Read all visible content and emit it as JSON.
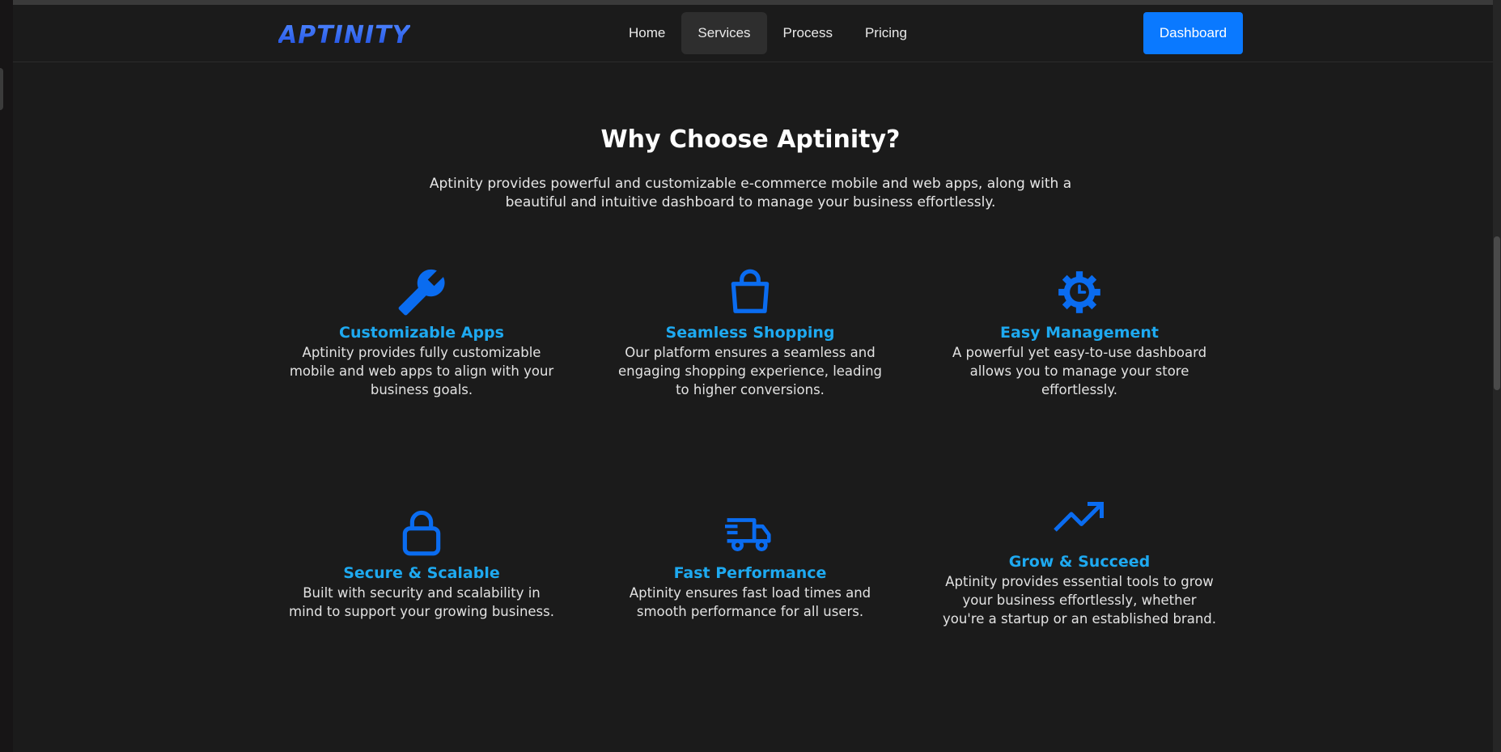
{
  "header": {
    "logo_text": "APTINITY",
    "nav": [
      {
        "label": "Home"
      },
      {
        "label": "Services"
      },
      {
        "label": "Process"
      },
      {
        "label": "Pricing"
      }
    ],
    "active_nav": "Services",
    "dashboard_label": "Dashboard"
  },
  "section": {
    "title": "Why Choose Aptinity?",
    "subtitle": "Aptinity provides powerful and customizable e-commerce mobile and web apps, along with a beautiful and intuitive dashboard to manage your business effortlessly."
  },
  "features": [
    {
      "icon": "tools-icon",
      "title": "Customizable Apps",
      "desc": "Aptinity provides fully customizable mobile and web apps to align with your business goals."
    },
    {
      "icon": "shopping-bag-icon",
      "title": "Seamless Shopping",
      "desc": "Our platform ensures a seamless and engaging shopping experience, leading to higher conversions."
    },
    {
      "icon": "gear-clock-icon",
      "title": "Easy Management",
      "desc": "A powerful yet easy-to-use dashboard allows you to manage your store effortlessly."
    },
    {
      "icon": "lock-icon",
      "title": "Secure & Scalable",
      "desc": "Built with security and scalability in mind to support your growing business."
    },
    {
      "icon": "delivery-truck-icon",
      "title": "Fast Performance",
      "desc": "Aptinity ensures fast load times and smooth performance for all users."
    },
    {
      "icon": "trending-up-icon",
      "title": "Grow & Succeed",
      "desc": "Aptinity provides essential tools to grow your business effortlessly, whether you're a startup or an established brand."
    }
  ],
  "colors": {
    "accent": "#0a79ff",
    "icon": "#0a6cf0",
    "feature_title": "#1ea9f0",
    "background": "#1b1b1b"
  }
}
